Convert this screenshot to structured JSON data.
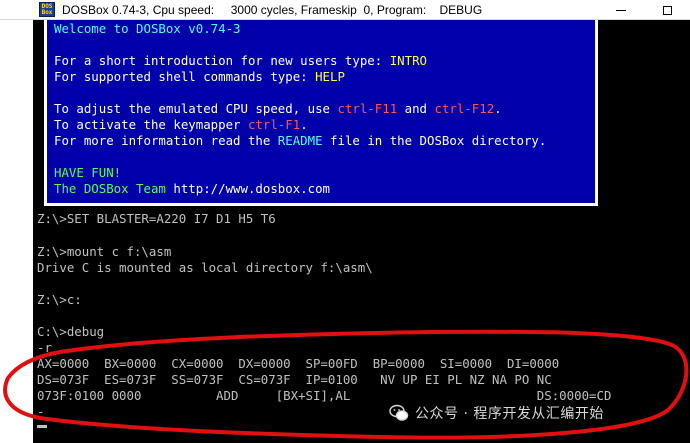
{
  "window": {
    "icon_label": "DOS Box",
    "title": "DOSBox 0.74-3, Cpu speed:     3000 cycles, Frameskip  0, Program:    DEBUG"
  },
  "welcome": {
    "line1": "Welcome to DOSBox v0.74-3",
    "intro_pre": "For a short introduction for new users type: ",
    "intro_cmd": "INTRO",
    "help_pre": "For supported shell commands type: ",
    "help_cmd": "HELP",
    "cpu_pre": "To adjust the emulated CPU speed, use ",
    "cpu_key1": "ctrl-F11",
    "cpu_mid": " and ",
    "cpu_key2": "ctrl-F12",
    "cpu_end": ".",
    "keymap_pre": "To activate the keymapper ",
    "keymap_key": "ctrl-F1",
    "keymap_end": ".",
    "readme_pre": "For more information read the ",
    "readme_word": "README",
    "readme_post": " file in the DOSBox directory.",
    "fun": "HAVE FUN!",
    "team": "The DOSBox Team ",
    "url": "http://www.dosbox.com"
  },
  "terminal": {
    "lines": [
      "Z:\\>SET BLASTER=A220 I7 D1 H5 T6",
      "",
      "Z:\\>mount c f:\\asm",
      "Drive C is mounted as local directory f:\\asm\\",
      "",
      "Z:\\>c:",
      "",
      "C:\\>debug",
      "-r",
      "AX=0000  BX=0000  CX=0000  DX=0000  SP=00FD  BP=0000  SI=0000  DI=0000",
      "DS=073F  ES=073F  SS=073F  CS=073F  IP=0100   NV UP EI PL NZ NA PO NC",
      "073F:0100 0000          ADD     [BX+SI],AL                         DS:0000=CD",
      "-"
    ]
  },
  "watermark": {
    "icon": "wechat-icon",
    "text": "公众号 · 程序开发从汇编开始"
  },
  "colors": {
    "console_bg": "#000000",
    "welcome_bg": "#0000aa",
    "annotation": "#e01010"
  }
}
